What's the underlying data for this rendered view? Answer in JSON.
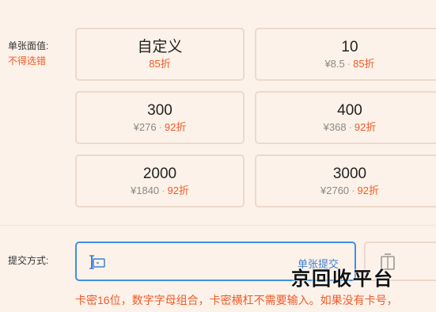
{
  "denomination": {
    "label": "单张面值:",
    "hint": "不得选错",
    "cards": [
      {
        "face": "自定义",
        "price": "",
        "discount": "85折"
      },
      {
        "face": "10",
        "price": "¥8.5",
        "discount": "85折"
      },
      {
        "face": "300",
        "price": "¥276",
        "discount": "92折"
      },
      {
        "face": "400",
        "price": "¥368",
        "discount": "92折"
      },
      {
        "face": "2000",
        "price": "¥1840",
        "discount": "92折"
      },
      {
        "face": "3000",
        "price": "¥2760",
        "discount": "92折"
      }
    ],
    "separator": "·"
  },
  "submit": {
    "label": "提交方式:",
    "mode_link": "单张提交",
    "input_icon": "text-cursor-icon",
    "scan_icon": "scan-icon"
  },
  "watermark": "京回收平台",
  "note": "卡密16位，数字字母组合，卡密横杠不需要输入。如果没有卡号，",
  "colors": {
    "background": "#fdf2e9",
    "accent": "#f05a28",
    "focus": "#3f8fe4",
    "card_border": "#ecd9cc"
  }
}
